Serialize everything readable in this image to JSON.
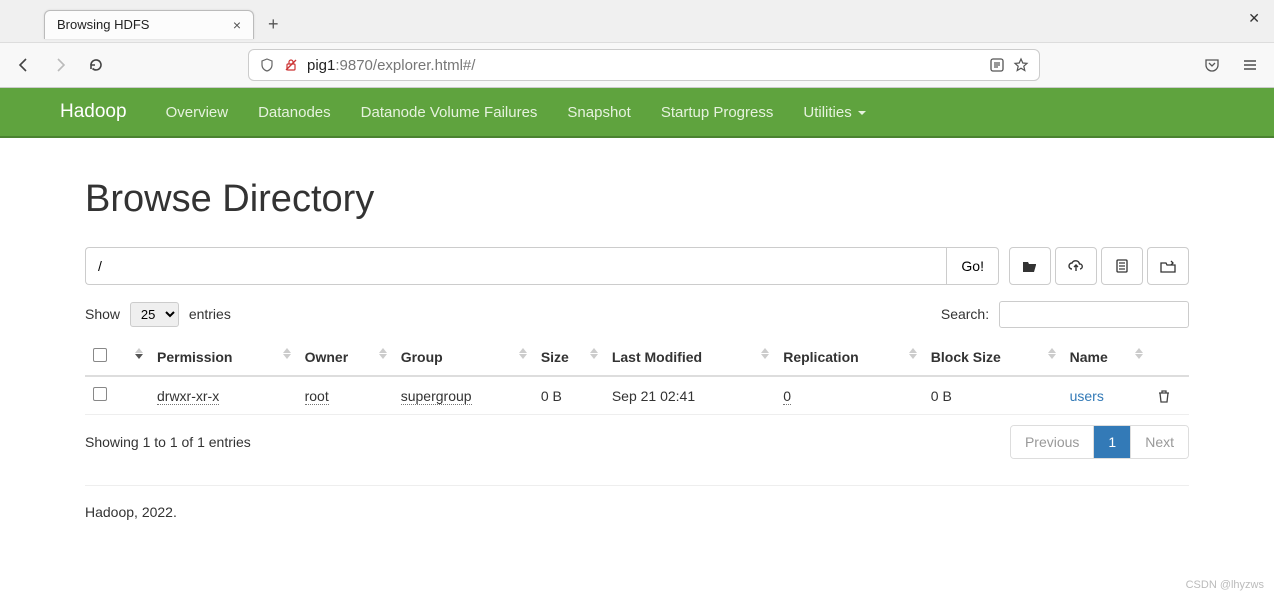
{
  "browser": {
    "tab_title": "Browsing HDFS",
    "url_host": "pig1",
    "url_rest": ":9870/explorer.html#/"
  },
  "nav": {
    "brand": "Hadoop",
    "items": [
      "Overview",
      "Datanodes",
      "Datanode Volume Failures",
      "Snapshot",
      "Startup Progress",
      "Utilities"
    ]
  },
  "page": {
    "heading": "Browse Directory",
    "path_value": "/",
    "go_label": "Go!",
    "show_label_pre": "Show",
    "show_label_post": "entries",
    "entries_selected": "25",
    "search_label": "Search:",
    "columns": [
      "",
      "",
      "Permission",
      "Owner",
      "Group",
      "Size",
      "Last Modified",
      "Replication",
      "Block Size",
      "Name",
      ""
    ],
    "rows": [
      {
        "permission": "drwxr-xr-x",
        "owner": "root",
        "group": "supergroup",
        "size": "0 B",
        "last_modified": "Sep 21 02:41",
        "replication": "0",
        "block_size": "0 B",
        "name": "users"
      }
    ],
    "info_text": "Showing 1 to 1 of 1 entries",
    "prev_label": "Previous",
    "page_number": "1",
    "next_label": "Next",
    "footer": "Hadoop, 2022."
  },
  "watermark": "CSDN @lhyzws"
}
